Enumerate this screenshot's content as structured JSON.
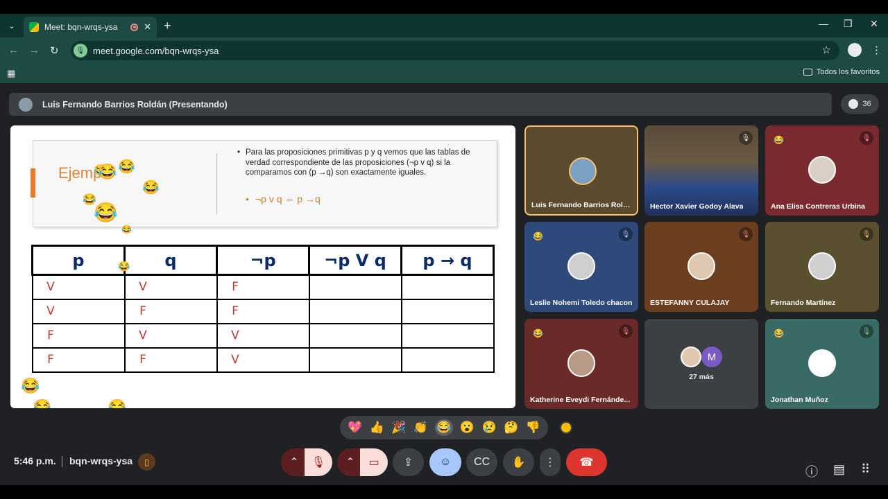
{
  "browser": {
    "tab_title": "Meet: bqn-wrqs-ysa",
    "url": "meet.google.com/bqn-wrqs-ysa",
    "bookmarks_label": "Todos los favoritos"
  },
  "meet": {
    "presenter_label": "Luis Fernando Barrios Roldán (Presentando)",
    "participant_count": "36",
    "time": "5:46 p.m.",
    "meeting_code": "bqn-wrqs-ysa",
    "more_label": "27 más",
    "more_initial": "M"
  },
  "slide": {
    "title_partial": "Ejemp",
    "bullet1": "Para las proposiciones primitivas p y q vemos que las tablas de verdad correspondiente de las proposiciones (¬p v q) si la comparamos con (p →q) son exactamente iguales.",
    "formula": "¬p v q ⇔ p →q",
    "table": {
      "headers": [
        "p",
        "q",
        "¬p",
        "¬p V q",
        "p → q"
      ],
      "rows": [
        [
          "V",
          "V",
          "F",
          "",
          ""
        ],
        [
          "V",
          "F",
          "F",
          "",
          ""
        ],
        [
          "F",
          "V",
          "V",
          "",
          ""
        ],
        [
          "F",
          "F",
          "V",
          "",
          ""
        ]
      ]
    }
  },
  "participants": [
    {
      "name": "Luis Fernando Barrios Roldán"
    },
    {
      "name": "Hector Xavier Godoy Alava"
    },
    {
      "name": "Ana Elisa Contreras Urbina"
    },
    {
      "name": "Leslie Nohemi Toledo chacon"
    },
    {
      "name": "ESTEFANNY CULAJAY"
    },
    {
      "name": "Fernando Martínez"
    },
    {
      "name": "Katherine Eveydi Fernánde..."
    },
    {
      "name": ""
    },
    {
      "name": "Jonathan Muñoz"
    }
  ],
  "reactions": [
    "💖",
    "👍",
    "🎉",
    "👏",
    "😂",
    "😮",
    "😢",
    "🤔",
    "👎"
  ],
  "colors": {
    "accent_orange": "#e87b30",
    "end_call": "#dc362e",
    "emoji_active": "#a8c7fa"
  }
}
